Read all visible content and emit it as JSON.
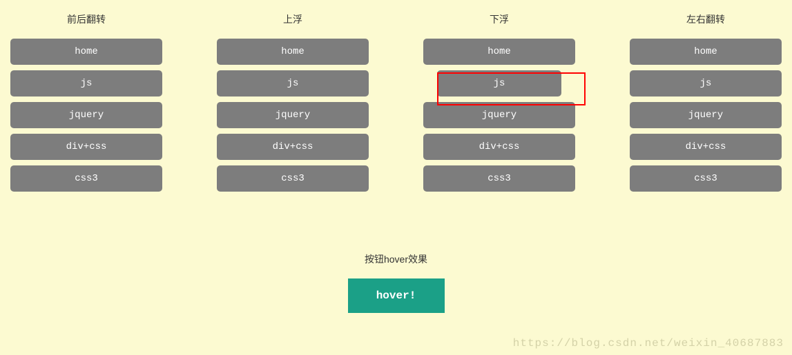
{
  "columns": [
    {
      "title": "前后翻转",
      "items": [
        "home",
        "js",
        "jquery",
        "div+css",
        "css3"
      ]
    },
    {
      "title": "上浮",
      "items": [
        "home",
        "js",
        "jquery",
        "div+css",
        "css3"
      ]
    },
    {
      "title": "下浮",
      "items": [
        "home",
        "js",
        "jquery",
        "div+css",
        "css3"
      ]
    },
    {
      "title": "左右翻转",
      "items": [
        "home",
        "js",
        "jquery",
        "div+css",
        "css3"
      ]
    }
  ],
  "bottom": {
    "title": "按钮hover效果",
    "button_label": "hover!"
  },
  "watermark": "https://blog.csdn.net/weixin_40687883",
  "highlight": {
    "column": 2,
    "item": 1
  }
}
